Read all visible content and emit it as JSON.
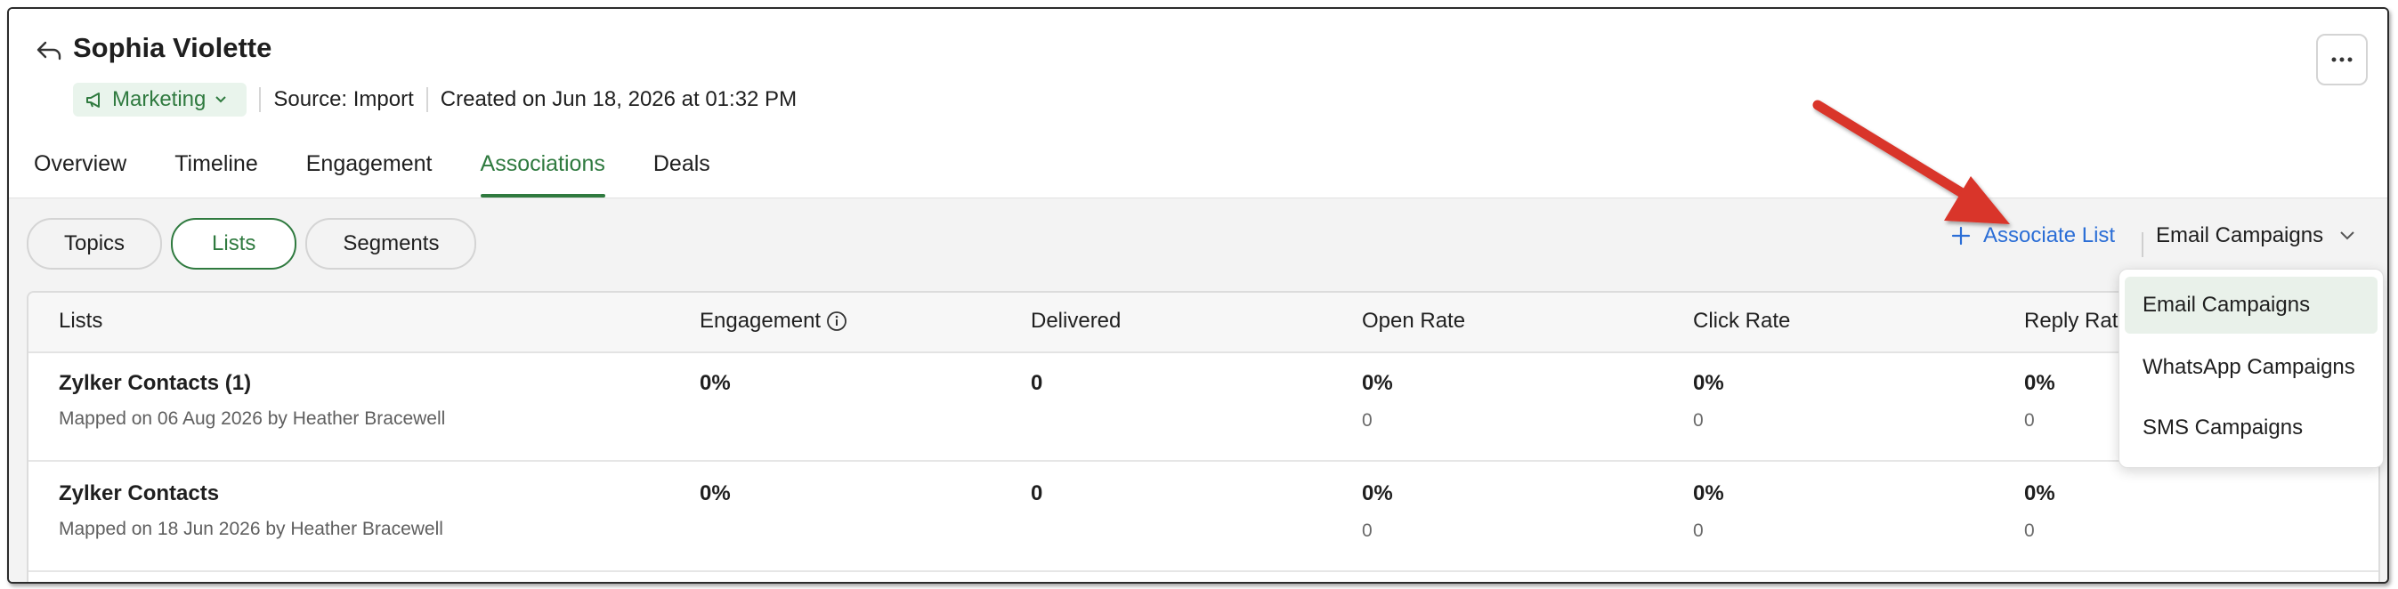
{
  "contact": {
    "name": "Sophia Violette",
    "tag": "Marketing",
    "source": "Source: Import",
    "created": "Created on Jun 18, 2026 at 01:32 PM"
  },
  "tabs": [
    "Overview",
    "Timeline",
    "Engagement",
    "Associations",
    "Deals"
  ],
  "active_tab": "Associations",
  "pills": [
    "Topics",
    "Lists",
    "Segments"
  ],
  "active_pill": "Lists",
  "actions": {
    "associate_list": "Associate List",
    "campaign_selected": "Email Campaigns"
  },
  "table": {
    "headers": [
      "Lists",
      "Engagement",
      "Delivered",
      "Open Rate",
      "Click Rate",
      "Reply Rate"
    ],
    "rows": [
      {
        "name": "Zylker Contacts (1)",
        "mapped": "Mapped on 06 Aug 2026 by Heather Bracewell",
        "engagement": "0%",
        "delivered": "0",
        "open_rate": "0%",
        "open_count": "0",
        "click_rate": "0%",
        "click_count": "0",
        "reply_rate": "0%",
        "reply_count": "0"
      },
      {
        "name": "Zylker Contacts",
        "mapped": "Mapped on 18 Jun 2026 by Heather Bracewell",
        "engagement": "0%",
        "delivered": "0",
        "open_rate": "0%",
        "open_count": "0",
        "click_rate": "0%",
        "click_count": "0",
        "reply_rate": "0%",
        "reply_count": "0"
      }
    ]
  },
  "dropdown": {
    "options": [
      "Email Campaigns",
      "WhatsApp Campaigns",
      "SMS Campaigns"
    ],
    "selected": "Email Campaigns"
  },
  "colors": {
    "accent_green": "#2f7a3f",
    "link_blue": "#2b6ed6",
    "annotation_arrow": "#d9342b"
  },
  "icons": [
    "back-arrow-icon",
    "megaphone-icon",
    "chevron-down-icon",
    "more-icon",
    "plus-icon",
    "info-icon"
  ]
}
